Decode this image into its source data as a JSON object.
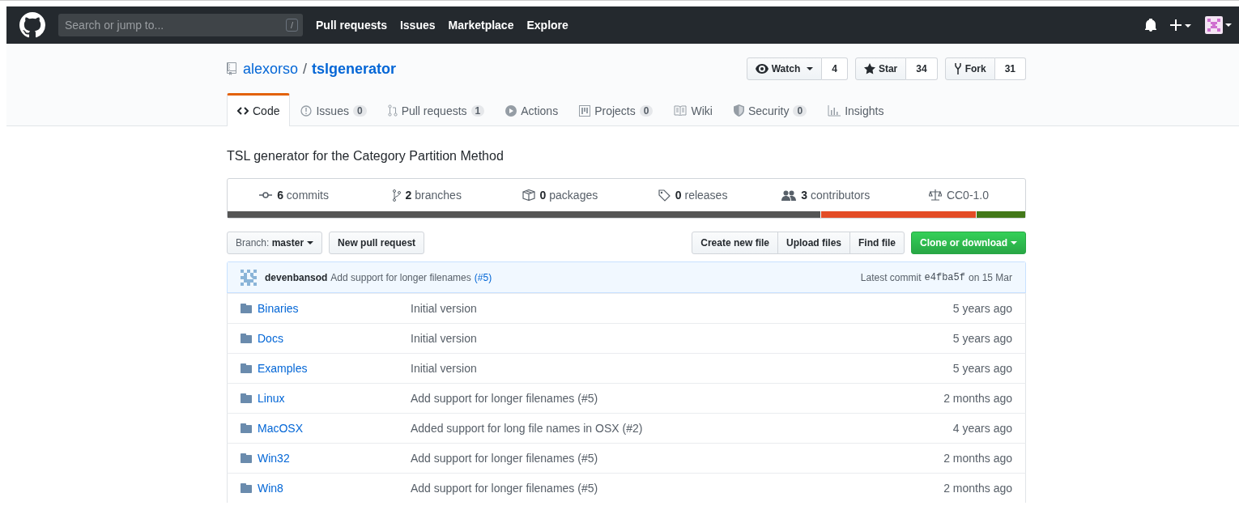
{
  "header": {
    "search": {
      "placeholder": "Search or jump to...",
      "key": "/"
    },
    "nav": [
      "Pull requests",
      "Issues",
      "Marketplace",
      "Explore"
    ]
  },
  "repo": {
    "owner": "alexorso",
    "separator": "/",
    "name": "tslgenerator"
  },
  "actions": [
    {
      "label": "Watch",
      "caret": true,
      "kind": "watch",
      "count": "4"
    },
    {
      "label": "Star",
      "caret": false,
      "kind": "star",
      "count": "34"
    },
    {
      "label": "Fork",
      "caret": false,
      "kind": "fork",
      "count": "31"
    }
  ],
  "tabs": [
    {
      "label": "Code",
      "kind": "code",
      "selected": true
    },
    {
      "label": "Issues",
      "kind": "issues",
      "count": "0",
      "selected": false
    },
    {
      "label": "Pull requests",
      "kind": "pulls",
      "count": "1",
      "selected": false
    },
    {
      "label": "Actions",
      "kind": "actions",
      "selected": false
    },
    {
      "label": "Projects",
      "kind": "projects",
      "count": "0",
      "selected": false
    },
    {
      "label": "Wiki",
      "kind": "wiki",
      "selected": false
    },
    {
      "label": "Security",
      "kind": "security",
      "count": "0",
      "selected": false
    },
    {
      "label": "Insights",
      "kind": "insights",
      "selected": false
    }
  ],
  "description": "TSL generator for the Category Partition Method",
  "summary": [
    {
      "kind": "commits",
      "text": "**6** commits"
    },
    {
      "kind": "branches",
      "text": "**2** branches"
    },
    {
      "kind": "packages",
      "text": "**0** packages"
    },
    {
      "kind": "releases",
      "text": "**0** releases"
    },
    {
      "kind": "contributors",
      "text": "**3** contributors"
    },
    {
      "kind": "license",
      "text": "CC0-1.0"
    }
  ],
  "toolbar": {
    "branch": "Branch: **master**",
    "new_pull_request": "New pull request",
    "file_buttons": [
      "Create new file",
      "Upload files",
      "Find file"
    ],
    "clone": "Clone or download"
  },
  "latest_commit": {
    "author": "devenbansod",
    "message": "Add support for longer filenames",
    "link": "(#5)",
    "label": "Latest commit",
    "sha": "e4fba5f",
    "date": "on 15 Mar"
  },
  "files": [
    {
      "name": "Binaries",
      "message": "Initial version",
      "age": "5 years ago"
    },
    {
      "name": "Docs",
      "message": "Initial version",
      "age": "5 years ago"
    },
    {
      "name": "Examples",
      "message": "Initial version",
      "age": "5 years ago"
    },
    {
      "name": "Linux",
      "message": "Add support for longer filenames (#5)",
      "age": "2 months ago"
    },
    {
      "name": "MacOSX",
      "message": "Added support for long file names in OSX (#2)",
      "age": "4 years ago"
    },
    {
      "name": "Win32",
      "message": "Add support for longer filenames (#5)",
      "age": "2 months ago"
    },
    {
      "name": "Win8",
      "message": "Add support for longer filenames (#5)",
      "age": "2 months ago"
    }
  ]
}
